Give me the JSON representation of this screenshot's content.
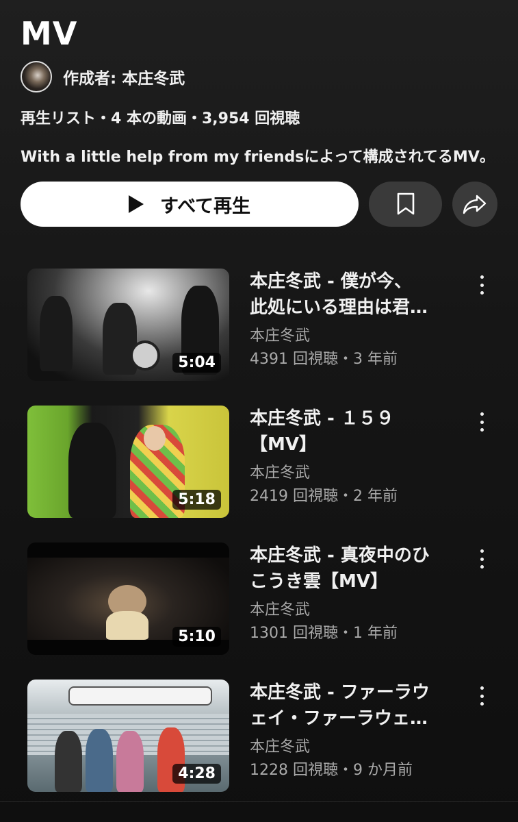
{
  "playlist": {
    "title": "MV",
    "author": "作成者: 本庄冬武",
    "meta": "再生リスト・4 本の動画・3,954 回視聴",
    "description": "With a little help from my friendsによって構成されてるMV。",
    "play_all_label": "すべて再生"
  },
  "videos": [
    {
      "title_line1": "本庄冬武 - 僕が今、",
      "title_line2": "此処にいる理由は君…",
      "channel": "本庄冬武",
      "stats": "4391 回視聴・3 年前",
      "duration": "5:04"
    },
    {
      "title_line1": "本庄冬武 - １５９",
      "title_line2": "【MV】",
      "channel": "本庄冬武",
      "stats": "2419 回視聴・2 年前",
      "duration": "5:18"
    },
    {
      "title_line1": "本庄冬武 - 真夜中のひ",
      "title_line2": "こうき雲【MV】",
      "channel": "本庄冬武",
      "stats": "1301 回視聴・1 年前",
      "duration": "5:10"
    },
    {
      "title_line1": "本庄冬武 - ファーラウ",
      "title_line2": "ェイ・ファーラウェ…",
      "channel": "本庄冬武",
      "stats": "1228 回視聴・9 か月前",
      "duration": "4:28"
    }
  ],
  "icons": {
    "play": "play-icon",
    "save": "bookmark-icon",
    "share": "share-icon",
    "menu": "more-vert-icon"
  }
}
